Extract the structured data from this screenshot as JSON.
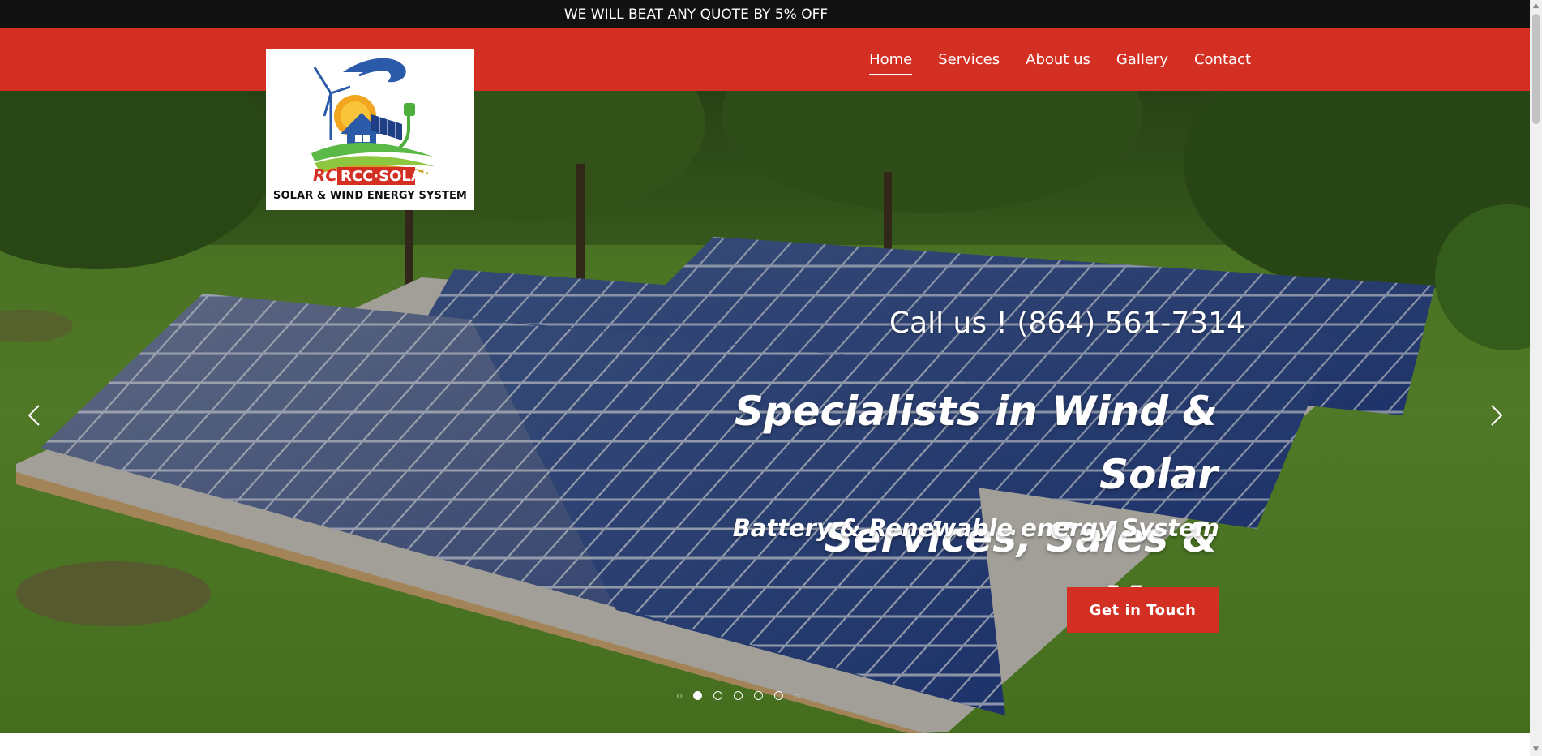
{
  "topbar": {
    "text": "WE WILL BEAT ANY QUOTE BY 5% OFF"
  },
  "nav": {
    "items": [
      {
        "label": "Home",
        "active": true
      },
      {
        "label": "Services"
      },
      {
        "label": "About us"
      },
      {
        "label": "Gallery"
      },
      {
        "label": "Contact"
      }
    ]
  },
  "logo": {
    "brand": "RCC·SOLAR",
    "tagline": "SOLAR & WIND ENERGY SYSTEM"
  },
  "hero": {
    "call_us": "Call us ! (864) 561-7314",
    "headline_line1": "Specialists in Wind & Solar",
    "headline_line2": "Services, Sales & More",
    "subline": "Battery & Renewable energy System",
    "cta_label": "Get in Touch",
    "slides": {
      "count": 6,
      "active_index": 0
    }
  },
  "colors": {
    "accent": "#d32f23",
    "topbar": "#121212"
  },
  "icons": [
    "chevron-left-icon",
    "chevron-right-icon",
    "logo-icon"
  ]
}
